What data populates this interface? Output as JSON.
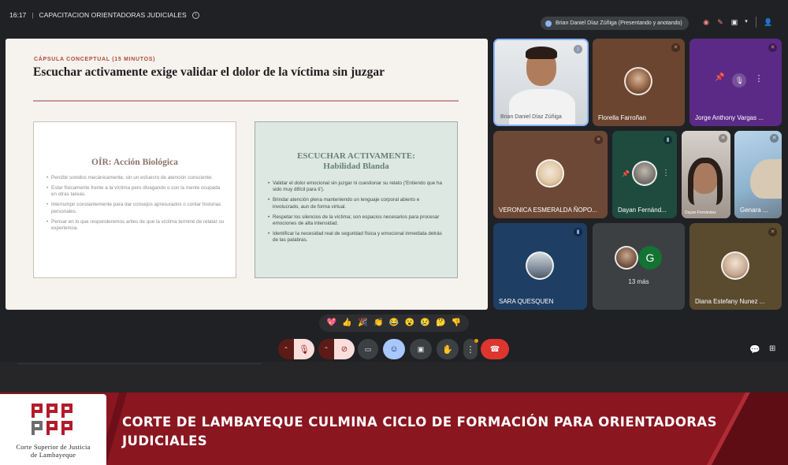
{
  "meeting": {
    "time": "16:17",
    "title": "CAPACITACION ORIENTADORAS JUDICIALES",
    "presenter_status": "Brian Daniel Díaz Zúñiga (Presentando y anotando)"
  },
  "slide": {
    "kicker": "CÁPSULA CONCEPTUAL (15 MINUTOS)",
    "heading": "Escuchar activamente exige validar el dolor de la víctima sin juzgar",
    "left_card": {
      "title": "OÍR: Acción Biológica",
      "bullets": [
        "Percibir sonidos mecánicamente, sin un esfuerzo de atención consciente.",
        "Estar físicamente frente a la víctima pero divagando o con la mente ocupada en otras tareas.",
        "Interrumpir constantemente para dar consejos apresurados o contar historias personales.",
        "Pensar en lo que responderemos antes de que la víctima termine de relatar su experiencia."
      ]
    },
    "right_card": {
      "title_line1": "ESCUCHAR ACTIVAMENTE:",
      "title_line2": "Habilidad Blanda",
      "bullets": [
        "Validar el dolor emocional sin juzgar ni cuestionar su relato ('Entiendo que ha sido muy difícil para ti').",
        "Brindar atención plena manteniendo un lenguaje corporal abierto e involucrado, aun de forma virtual.",
        "Respetar los silencios de la víctima; son espacios necesarios para procesar emociones de alta intensidad.",
        "Identificar la necesidad real de seguridad física y emocional inmediata detrás de las palabras."
      ]
    }
  },
  "participants": {
    "presenter_label": "Brian Daniel Díaz Zúñiga",
    "florella": "Florella Farroñan",
    "jorge": "Jorge Anthony Vargas ...",
    "veronica": "VERONICA ESMERALDA ÑOPO...",
    "dayan": "Dayan Fernánd...",
    "dayan_overlay": "Dayan Fernández",
    "genara": "Genara ...",
    "sara": "SARA QUESQUEN",
    "more_count": "13 más",
    "more_avatar_letter": "G",
    "diana": "Diana Estefany Nunez ..."
  },
  "reactions": [
    "💖",
    "👍",
    "🎉",
    "👏",
    "😂",
    "😮",
    "😢",
    "🤔",
    "👎"
  ],
  "banner": {
    "headline": "CORTE DE LAMBAYEQUE CULMINA CICLO DE FORMACIÓN PARA ORIENTADORAS JUDICIALES",
    "logo_line1": "Corte Superior de Justicia",
    "logo_line2": "de Lambayeque"
  },
  "colors": {
    "meet_bg": "#202124",
    "banner_red": "#8a1620",
    "end_call": "#dc362e",
    "slide_bg": "#f6f3ee",
    "right_card_bg": "#dde8e3"
  }
}
